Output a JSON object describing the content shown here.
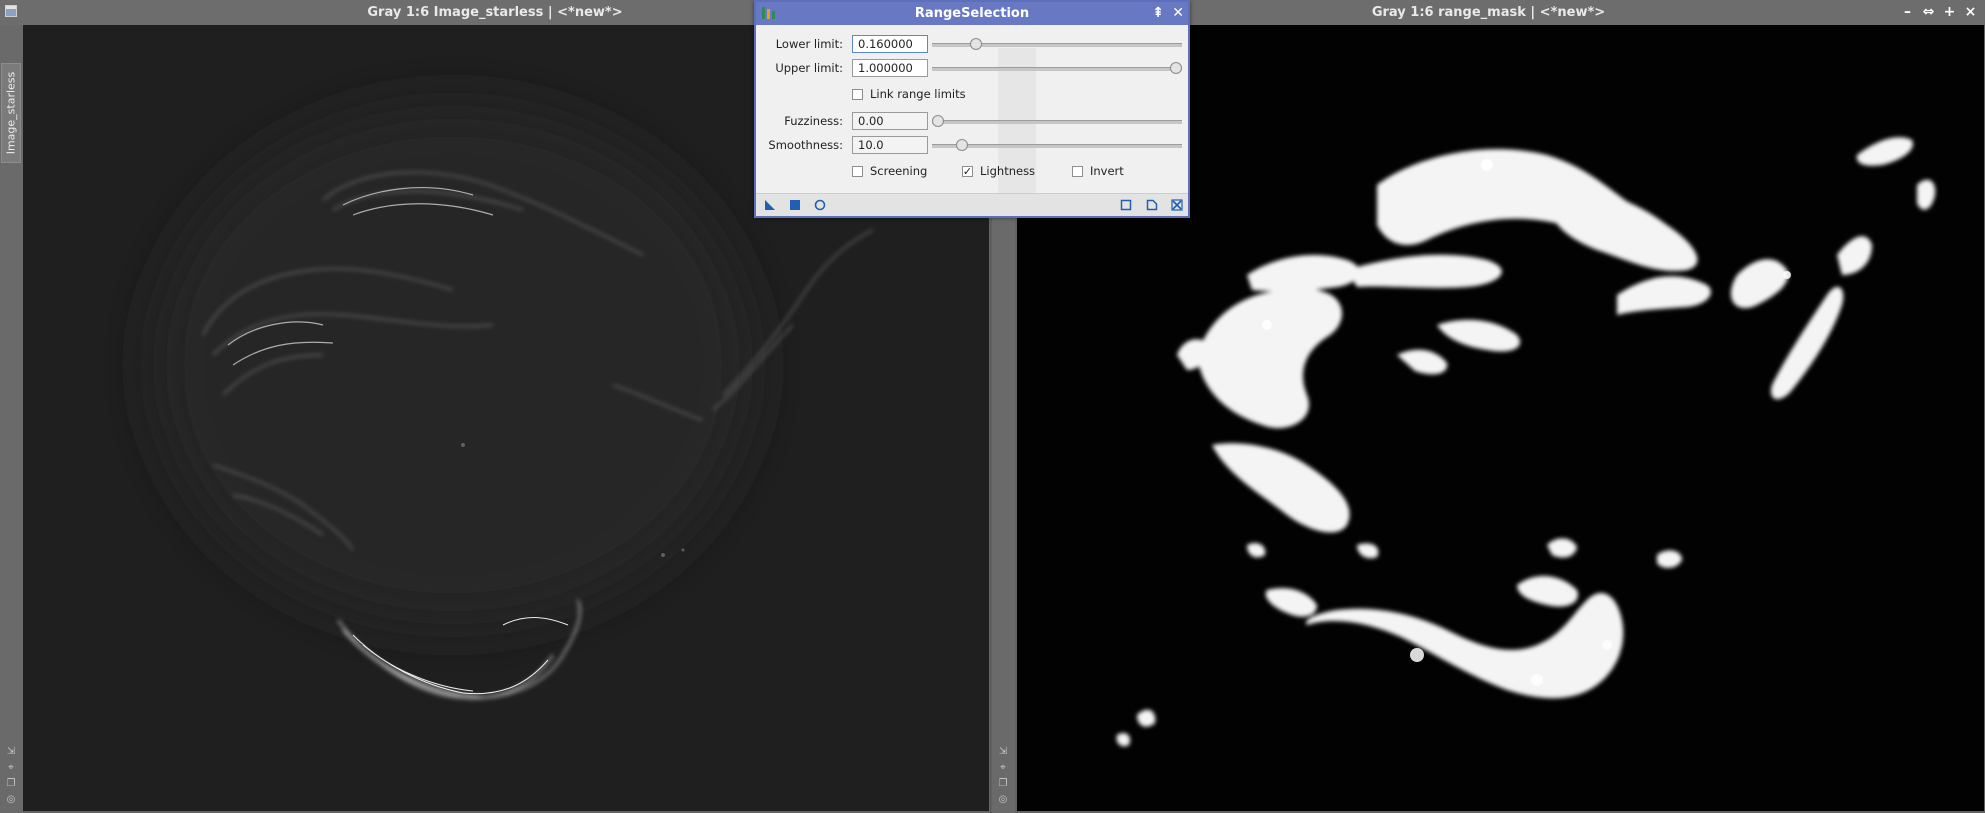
{
  "left_window": {
    "title": "Gray 1:6 Image_starless | <*new*>",
    "side_tab": "Image_starless"
  },
  "right_window": {
    "title": "Gray 1:6 range_mask | <*new*>",
    "controls": [
      "–",
      "⇔",
      "+",
      "×"
    ]
  },
  "dialog": {
    "title": "RangeSelection",
    "lower_label": "Lower limit:",
    "lower_value": "0.160000",
    "lower_slider": 0.16,
    "upper_label": "Upper limit:",
    "upper_value": "1.000000",
    "upper_slider": 1.0,
    "link_label": "Link range limits",
    "link_checked": false,
    "fuzziness_label": "Fuzziness:",
    "fuzziness_value": "0.00",
    "fuzziness_slider": 0.0,
    "smoothness_label": "Smoothness:",
    "smoothness_value": "10.0",
    "smoothness_slider": 0.1,
    "screening_label": "Screening",
    "screening_checked": false,
    "lightness_label": "Lightness",
    "lightness_checked": true,
    "invert_label": "Invert",
    "invert_checked": false
  },
  "colors": {
    "dialog_title": "#6878c3",
    "footer_icon": "#1f5fb4",
    "workspace": "#5f5f5f"
  },
  "icons": [
    "new-instance-icon",
    "apply-icon",
    "apply-global-icon",
    "preview-icon",
    "reset-icon",
    "close-panel-icon"
  ]
}
